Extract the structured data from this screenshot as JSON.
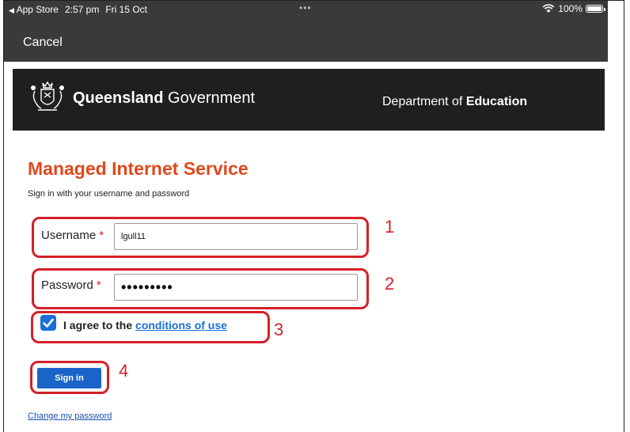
{
  "status_bar": {
    "back_app": "App Store",
    "time": "2:57 pm",
    "date": "Fri 15 Oct",
    "dots": "•••",
    "battery": "100%"
  },
  "nav": {
    "cancel": "Cancel"
  },
  "header": {
    "logo_bold": "Queensland",
    "logo_regular": " Government",
    "dept_regular": "Department of ",
    "dept_bold": "Education"
  },
  "page": {
    "title": "Managed Internet Service",
    "subtitle": "Sign in with your username and password"
  },
  "form": {
    "username_label": "Username",
    "username_value": "lgull11",
    "password_label": "Password",
    "password_value": "•••••••••",
    "required_mark": "*",
    "agree_text": "I agree to the ",
    "agree_link": "conditions of use",
    "agree_checked": true,
    "signin_label": "Sign in",
    "change_password": "Change my password"
  },
  "annotations": {
    "n1": "1",
    "n2": "2",
    "n3": "3",
    "n4": "4",
    "color": "#d42028"
  },
  "colors": {
    "accent_orange": "#e0481b",
    "link_blue": "#1a6fd8",
    "button_blue": "#1a64c8",
    "header_dark": "#1f1f1f",
    "ios_bar": "#3a3a3a"
  }
}
